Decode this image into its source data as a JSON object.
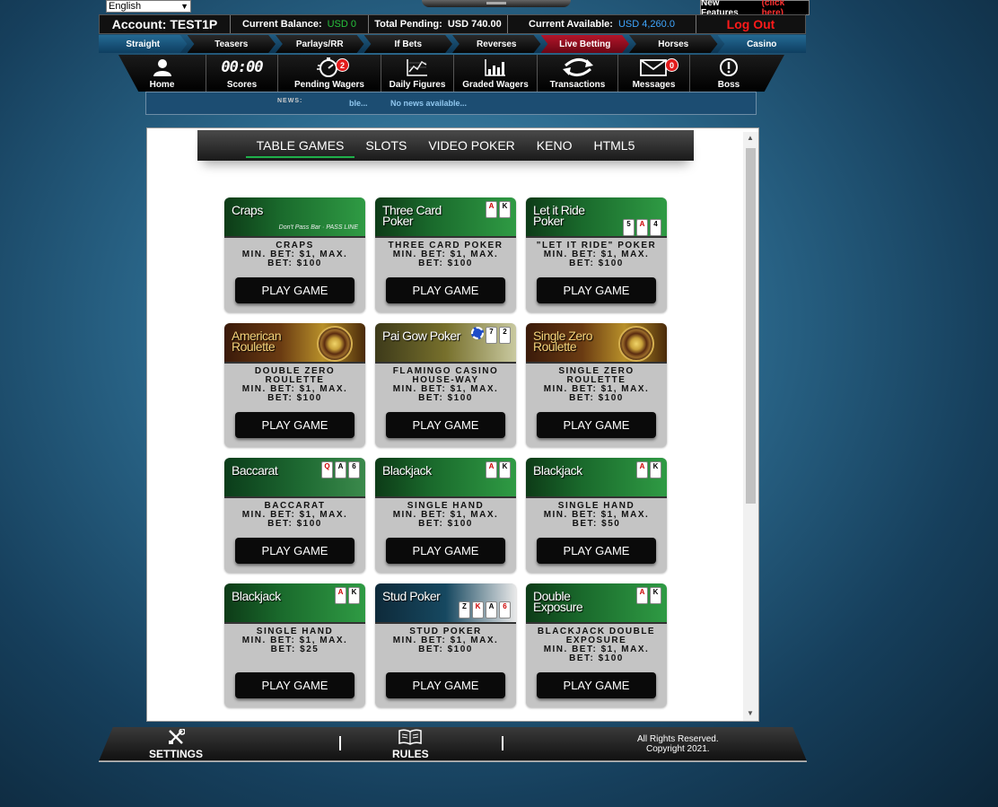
{
  "language": {
    "selected": "English"
  },
  "new_features": {
    "label": "New Features",
    "link": "(click here)"
  },
  "account": {
    "label": "Account: TEST1P",
    "balance_label": "Current Balance:",
    "balance_value": "USD 0",
    "pending_label": "Total Pending:",
    "pending_value": "USD 740.00",
    "available_label": "Current Available:",
    "available_value": "USD 4,260.0",
    "logout": "Log Out"
  },
  "sports_nav": [
    "Straight",
    "Teasers",
    "Parlays/RR",
    "If Bets",
    "Reverses",
    "Live Betting",
    "Horses",
    "Casino"
  ],
  "sports_nav_active": "Live Betting",
  "main_nav": [
    {
      "label": "Home",
      "icon": "user-icon"
    },
    {
      "label": "Scores",
      "icon": "clock-digits-icon",
      "digits": "00:00"
    },
    {
      "label": "Pending Wagers",
      "icon": "stopwatch-icon",
      "badge": "2"
    },
    {
      "label": "Daily Figures",
      "icon": "line-chart-icon"
    },
    {
      "label": "Graded Wagers",
      "icon": "bar-chart-icon"
    },
    {
      "label": "Transactions",
      "icon": "refresh-arrows-icon"
    },
    {
      "label": "Messages",
      "icon": "envelope-icon",
      "badge": "0"
    },
    {
      "label": "Boss",
      "icon": "alert-icon"
    }
  ],
  "news": {
    "label": "NEWS:",
    "ticker_fragment": "ble...",
    "ticker_text": "No news available..."
  },
  "casino_tabs": [
    "TABLE GAMES",
    "SLOTS",
    "VIDEO POKER",
    "KENO",
    "HTML5"
  ],
  "casino_tabs_active": "TABLE GAMES",
  "games": [
    {
      "banner": "Craps",
      "name": "CRAPS",
      "limits": "MIN. BET: $1, MAX. BET: $100",
      "button": "PLAY GAME"
    },
    {
      "banner": "Three Card Poker",
      "name": "THREE CARD POKER",
      "limits": "MIN. BET: $1, MAX. BET: $100",
      "button": "PLAY GAME"
    },
    {
      "banner": "Let it Ride Poker",
      "name": "\"LET IT RIDE\" POKER",
      "limits": "MIN. BET: $1, MAX. BET: $100",
      "button": "PLAY GAME"
    },
    {
      "banner": "American Roulette",
      "name": "DOUBLE ZERO ROULETTE",
      "limits": "MIN. BET: $1, MAX. BET: $100",
      "button": "PLAY GAME"
    },
    {
      "banner": "Pai Gow Poker",
      "name": "FLAMINGO CASINO HOUSE-WAY",
      "limits": "MIN. BET: $1, MAX. BET: $100",
      "button": "PLAY GAME"
    },
    {
      "banner": "Single Zero Roulette",
      "name": "SINGLE ZERO ROULETTE",
      "limits": "MIN. BET: $1, MAX. BET: $100",
      "button": "PLAY GAME"
    },
    {
      "banner": "Baccarat",
      "name": "BACCARAT",
      "limits": "MIN. BET: $1, MAX. BET: $100",
      "button": "PLAY GAME"
    },
    {
      "banner": "Blackjack",
      "name": "SINGLE HAND",
      "limits": "MIN. BET: $1, MAX. BET: $100",
      "button": "PLAY GAME"
    },
    {
      "banner": "Blackjack",
      "name": "SINGLE HAND",
      "limits": "MIN. BET: $1, MAX. BET: $50",
      "button": "PLAY GAME"
    },
    {
      "banner": "Blackjack",
      "name": "SINGLE HAND",
      "limits": "MIN. BET: $1, MAX. BET: $25",
      "button": "PLAY GAME"
    },
    {
      "banner": "Stud Poker",
      "name": "STUD POKER",
      "limits": "MIN. BET: $1, MAX. BET: $100",
      "button": "PLAY GAME"
    },
    {
      "banner": "Double Exposure",
      "name": "BLACKJACK DOUBLE EXPOSURE",
      "limits": "MIN. BET: $1, MAX. BET: $100",
      "button": "PLAY GAME"
    }
  ],
  "footer": {
    "settings": "SETTINGS",
    "rules": "RULES",
    "rights": "All Rights Reserved.",
    "copyright": "Copyright 2021."
  }
}
